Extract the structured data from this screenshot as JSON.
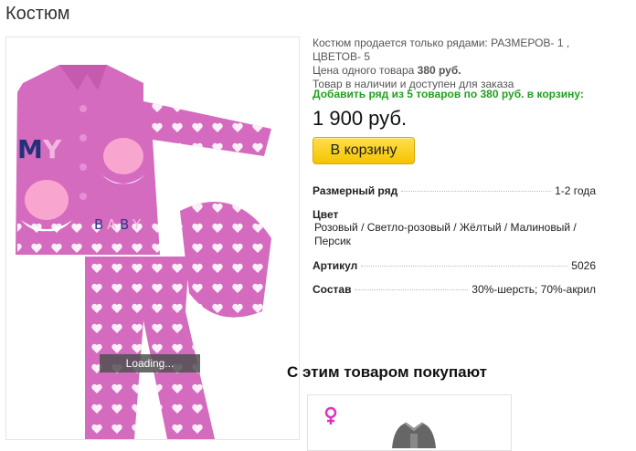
{
  "page": {
    "title": "Костюм"
  },
  "image": {
    "loading_text": "Loading...",
    "alt": "Костюм"
  },
  "description": {
    "line1": "Костюм продается только рядами: РАЗМЕРОВ- 1 , ЦВЕТОВ- 5",
    "line2_prefix": "Цена одного товара ",
    "line2_price": "380 руб.",
    "line3": "Товар в наличии и доступен для заказа"
  },
  "add_row_text": "Добавить ряд из 5 товаров по 380 руб. в корзину:",
  "price": "1 900 руб.",
  "cart_button": "В корзину",
  "specs": {
    "size_label": "Размерный ряд",
    "size_value": "1-2 года",
    "color_label": "Цвет",
    "color_value": "Розовый / Светло-розовый / Жёлтый / Малиновый / Персик",
    "article_label": "Артикул",
    "article_value": "5026",
    "composition_label": "Состав",
    "composition_value": "30%-шерсть; 70%-акрил"
  },
  "related": {
    "title": "С этим товаром покупают",
    "icon": "female-icon"
  },
  "colors": {
    "accent_green": "#22a022",
    "button_yellow": "#f5c400",
    "product_pink": "#d46bbf",
    "female_icon": "#e030c0"
  }
}
